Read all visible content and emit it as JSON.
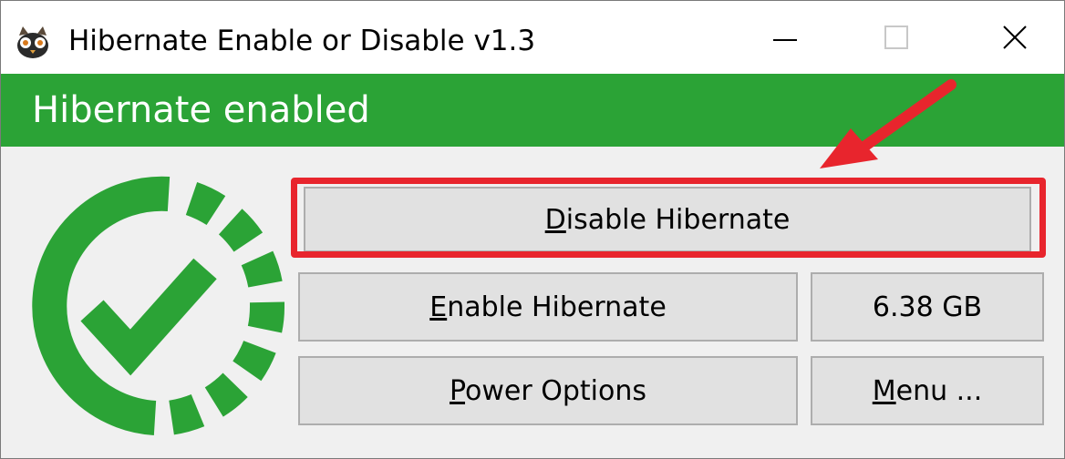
{
  "window": {
    "title": "Hibernate Enable or Disable v1.3"
  },
  "status": {
    "text": "Hibernate enabled",
    "color": "#2ba336"
  },
  "buttons": {
    "disable_accel": "D",
    "disable_rest": "isable Hibernate",
    "enable_accel": "E",
    "enable_rest": "nable Hibernate",
    "size_label": "6.38 GB",
    "power_accel": "P",
    "power_rest": "ower Options",
    "menu_accel": "M",
    "menu_rest": "enu ..."
  },
  "icons": {
    "app": "hibernate-app-icon",
    "logo": "green-check-circle-icon",
    "minimize": "minimize-icon",
    "maximize": "maximize-icon",
    "close": "close-icon",
    "annotation": "red-arrow-icon"
  },
  "colors": {
    "accent_green": "#2ba336",
    "highlight_red": "#e8252d",
    "button_face": "#e1e1e1"
  }
}
